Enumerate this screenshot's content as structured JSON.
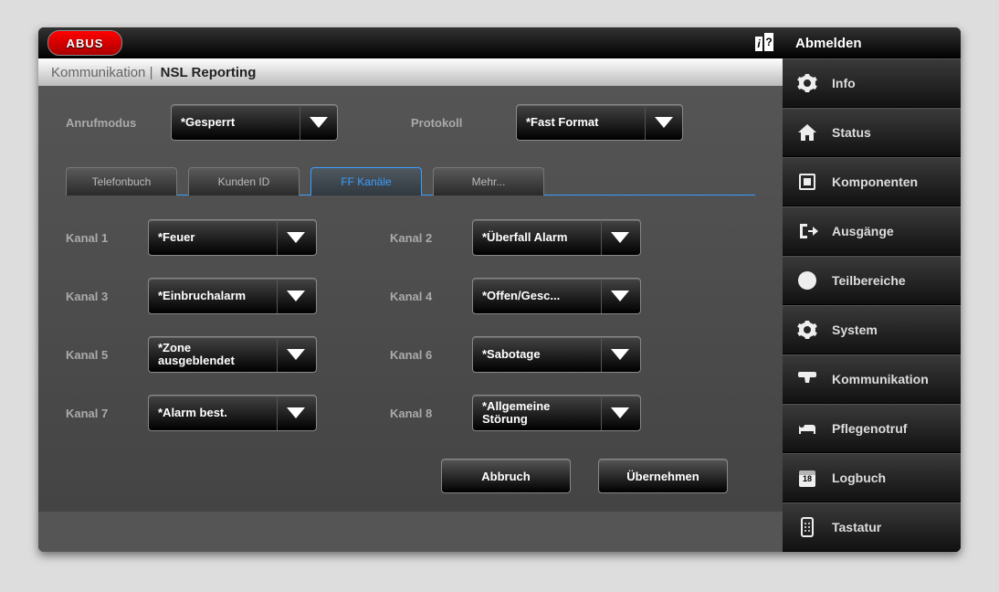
{
  "logo_text": "ABUS",
  "breadcrumb": {
    "parent": "Kommunikation",
    "sep": "|",
    "current": "NSL Reporting"
  },
  "top": {
    "anrufmodus_label": "Anrufmodus",
    "anrufmodus_value": "*Gesperrt",
    "protokoll_label": "Protokoll",
    "protokoll_value": "*Fast Format"
  },
  "tabs": {
    "telefonbuch": "Telefonbuch",
    "kundenid": "Kunden ID",
    "ffkanaele": "FF Kanäle",
    "mehr": "Mehr..."
  },
  "channels": {
    "k1_label": "Kanal 1",
    "k1_value": "*Feuer",
    "k2_label": "Kanal 2",
    "k2_value": "*Überfall Alarm",
    "k3_label": "Kanal 3",
    "k3_value": "*Einbruchalarm",
    "k4_label": "Kanal 4",
    "k4_value": "*Offen/Gesc...",
    "k5_label": "Kanal 5",
    "k5_value": "*Zone ausgeblendet",
    "k6_label": "Kanal 6",
    "k6_value": "*Sabotage",
    "k7_label": "Kanal 7",
    "k7_value": "*Alarm best.",
    "k8_label": "Kanal 8",
    "k8_value": "*Allgemeine Störung"
  },
  "actions": {
    "cancel": "Abbruch",
    "apply": "Übernehmen"
  },
  "logout": "Abmelden",
  "nav": {
    "info": "Info",
    "status": "Status",
    "komponenten": "Komponenten",
    "ausgaenge": "Ausgänge",
    "teilbereiche": "Teilbereiche",
    "system": "System",
    "kommunikation": "Kommunikation",
    "pflegenotruf": "Pflegenotruf",
    "logbuch": "Logbuch",
    "logbuch_day": "18",
    "tastatur": "Tastatur"
  }
}
